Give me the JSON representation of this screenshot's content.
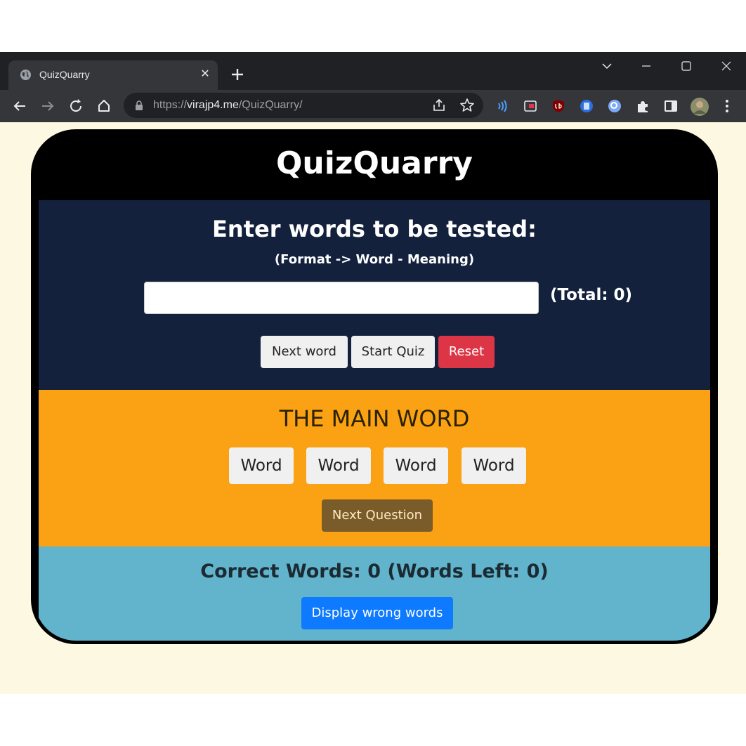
{
  "browser": {
    "tab_title": "QuizQuarry",
    "url_prefix": "https://",
    "url_host": "virajp4.me",
    "url_path": "/QuizQuarry/",
    "new_tab_symbol": "+",
    "close_symbol": "✕"
  },
  "app": {
    "title": "QuizQuarry",
    "input_section": {
      "heading": "Enter words to be tested:",
      "format_hint": "(Format -> Word - Meaning)",
      "input_value": "",
      "input_placeholder": "",
      "total_label": "(Total: 0)",
      "buttons": {
        "next_word": "Next word",
        "start_quiz": "Start Quiz",
        "reset": "Reset"
      }
    },
    "quiz_section": {
      "main_word": "THE MAIN WORD",
      "options": [
        "Word",
        "Word",
        "Word",
        "Word"
      ],
      "next_question": "Next Question"
    },
    "score_section": {
      "score_text": "Correct Words: 0 (Words Left: 0)",
      "display_wrong": "Display wrong words"
    }
  },
  "colors": {
    "page_bg": "#fdf8e1",
    "input_section_bg": "#13213d",
    "quiz_section_bg": "#faa214",
    "score_section_bg": "#61b4cb",
    "reset_button": "#dc3545",
    "next_question_button": "#7a5c2a",
    "display_wrong_button": "#0d7aff"
  }
}
